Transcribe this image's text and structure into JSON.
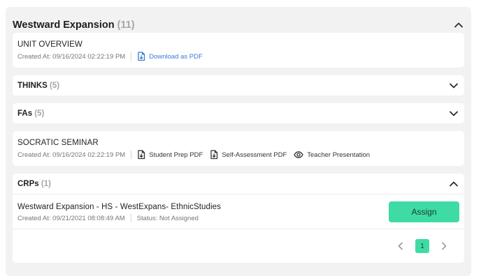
{
  "unit": {
    "title": "Westward Expansion",
    "count": "(11)"
  },
  "overview": {
    "title": "UNIT OVERVIEW",
    "created": "Created At: 09/16/2024 02:22:19 PM",
    "download_label": "Download as PDF"
  },
  "thinks": {
    "title": "THINKS",
    "count": "(5)"
  },
  "fas": {
    "title": "FAs",
    "count": "(5)"
  },
  "socratic": {
    "title": "SOCRATIC SEMINAR",
    "created": "Created At: 09/16/2024 02:22:19 PM",
    "actions": [
      "Student Prep PDF",
      "Self-Assessment PDF",
      "Teacher Presentation"
    ]
  },
  "crps": {
    "title": "CRPs",
    "count": "(1)",
    "item": {
      "title": "Westward Expansion - HS - WestExpans- EthnicStudies",
      "created": "Created At: 09/21/2021 08:08:49 AM",
      "status": "Status: Not Assigned",
      "assign_label": "Assign"
    },
    "pagination": {
      "current_page": "1"
    }
  },
  "colors": {
    "accent": "#3fdba4",
    "link": "#3b7bd6",
    "panel_bg": "#f2f2f2"
  },
  "icons": [
    "chevron-up-icon",
    "chevron-down-icon",
    "file-download-icon",
    "eye-icon",
    "chevron-left-icon",
    "chevron-right-icon"
  ]
}
